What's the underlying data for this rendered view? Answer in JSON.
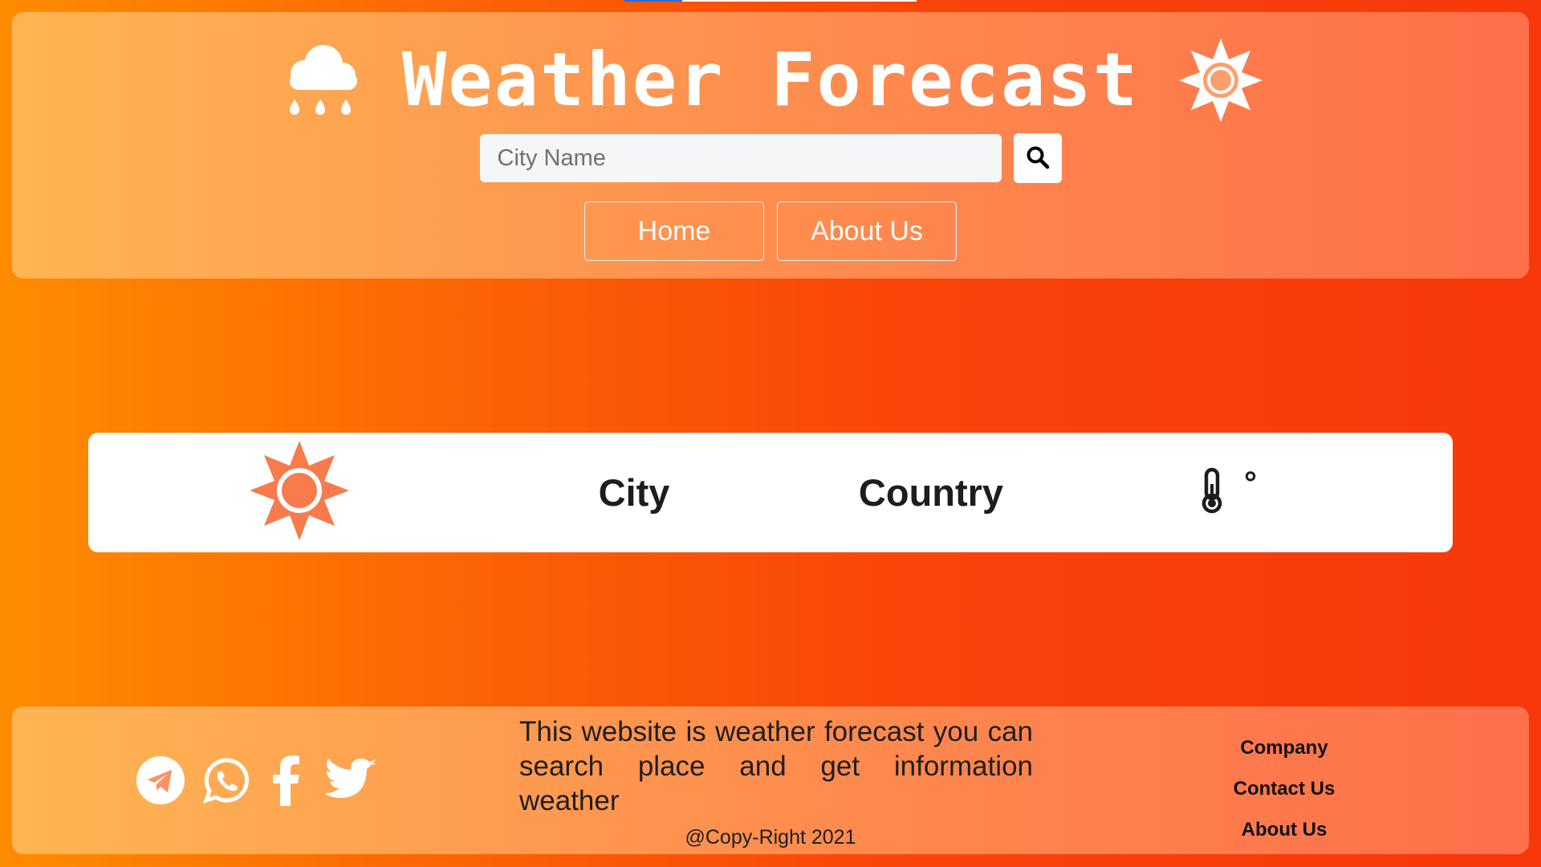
{
  "header": {
    "title": "Weather Forecast",
    "left_icon": "cloud-rain-icon",
    "right_icon": "sun-icon"
  },
  "search": {
    "placeholder": "City Name",
    "value": "",
    "button_icon": "search-icon"
  },
  "nav": {
    "home_label": "Home",
    "about_label": "About Us"
  },
  "weather_card": {
    "icon": "sun-icon",
    "city_label": "City",
    "country_label": "Country",
    "temp_icon": "thermometer-icon",
    "degree_symbol": "°"
  },
  "footer": {
    "social_icons": [
      "telegram-icon",
      "whatsapp-icon",
      "facebook-icon",
      "twitter-icon"
    ],
    "description": "This website is weather forecast you can search place and get information weather",
    "copyright": "@Copy-Right 2021",
    "links": {
      "company": "Company",
      "contact": "Contact Us",
      "about": "About Us"
    }
  },
  "colors": {
    "accent": "#f77b4d",
    "background_start": "#ff8c00",
    "background_end": "#f7380a",
    "text_dark": "#1d1d1d",
    "white": "#ffffff"
  }
}
